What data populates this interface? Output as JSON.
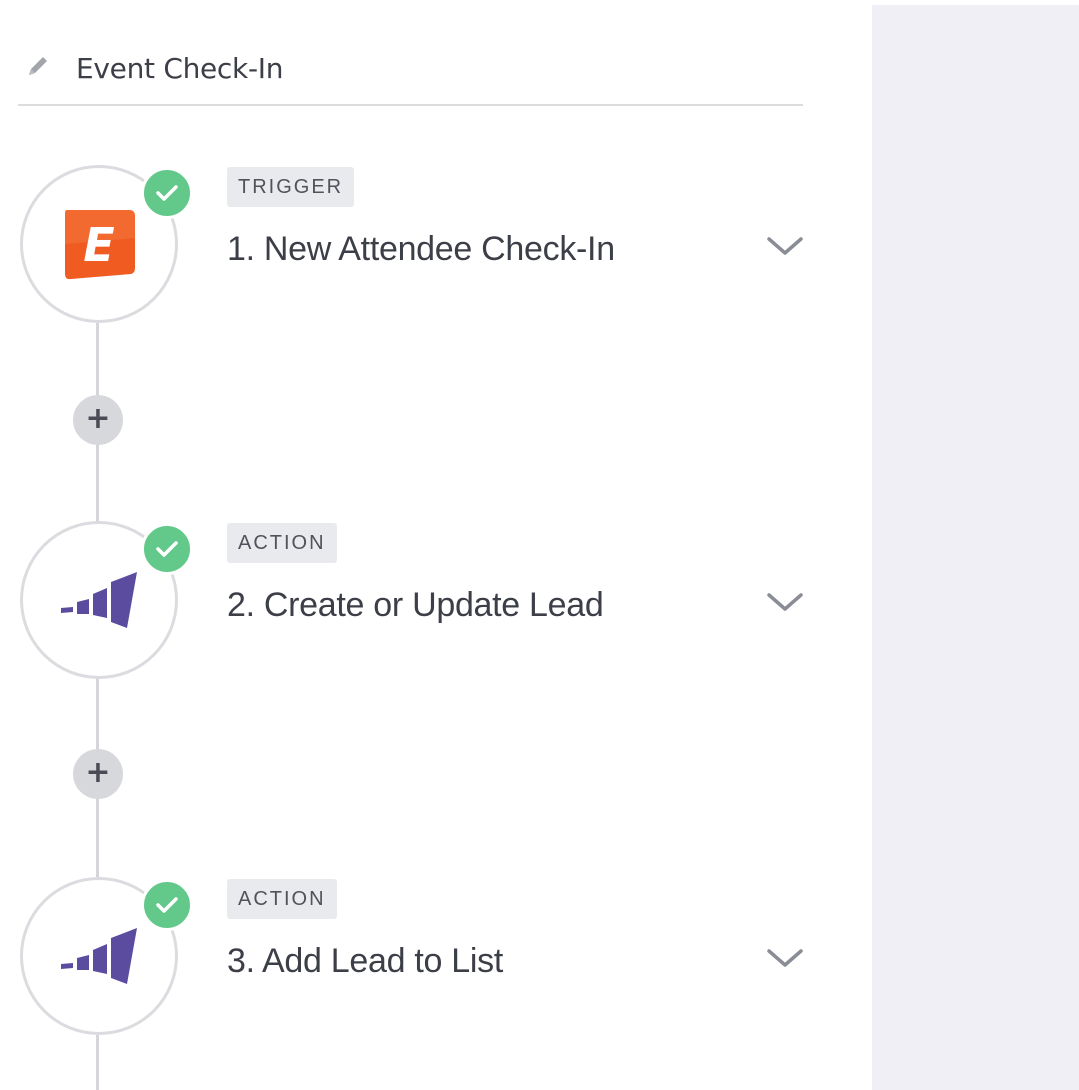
{
  "zap": {
    "title": "Event Check-In"
  },
  "steps": [
    {
      "tag": "TRIGGER",
      "title": "1. New Attendee Check-In",
      "app_icon": "eventbrite-icon",
      "status_icon": "check-icon"
    },
    {
      "tag": "ACTION",
      "title": "2. Create or Update Lead",
      "app_icon": "marketo-icon",
      "status_icon": "check-icon"
    },
    {
      "tag": "ACTION",
      "title": "3. Add Lead to List",
      "app_icon": "marketo-icon",
      "status_icon": "check-icon"
    }
  ],
  "add_step": {
    "symbol": "+"
  },
  "colors": {
    "eventbrite_orange": "#f05b22",
    "marketo_purple": "#5c4c9f",
    "success_green": "#63c98a",
    "panel_bg": "#f0eff5"
  }
}
